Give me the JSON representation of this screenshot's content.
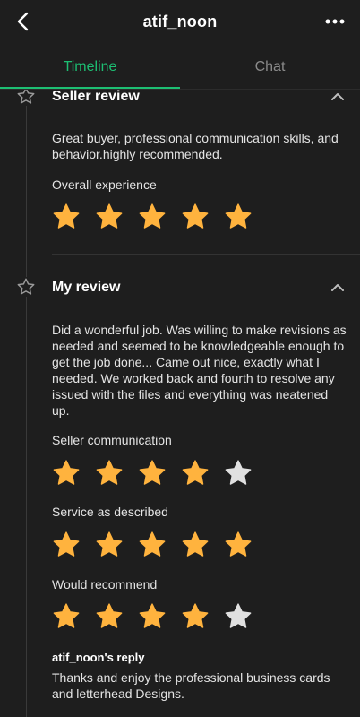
{
  "header": {
    "title": "atif_noon"
  },
  "tabs": [
    {
      "label": "Timeline",
      "active": true
    },
    {
      "label": "Chat",
      "active": false
    }
  ],
  "seller_review": {
    "title": "Seller review",
    "text": "Great buyer, professional communication skills, and behavior.highly recommended.",
    "overall_label": "Overall experience",
    "overall_rating": 5
  },
  "my_review": {
    "title": "My review",
    "text": "Did a wonderful job. Was willing to make revisions as needed and seemed to be knowledgeable enough to get the job done... Came out nice, exactly what I needed. We worked back and fourth to resolve any issued with the files and everything was neatened up.",
    "ratings": [
      {
        "label": "Seller communication",
        "value": 4
      },
      {
        "label": "Service as described",
        "value": 5
      },
      {
        "label": "Would recommend",
        "value": 4
      }
    ],
    "reply_title": "atif_noon's reply",
    "reply_text": "Thanks and enjoy the professional business cards and letterhead Designs."
  },
  "colors": {
    "accent": "#1dbf73",
    "star_filled": "#ffb33e",
    "star_empty": "#e0e0e0",
    "background": "#1e1e1e"
  },
  "icons": {
    "back": "chevron-left-icon",
    "more": "more-horizontal-icon",
    "section": "star-outline-icon",
    "collapse": "chevron-up-icon"
  }
}
